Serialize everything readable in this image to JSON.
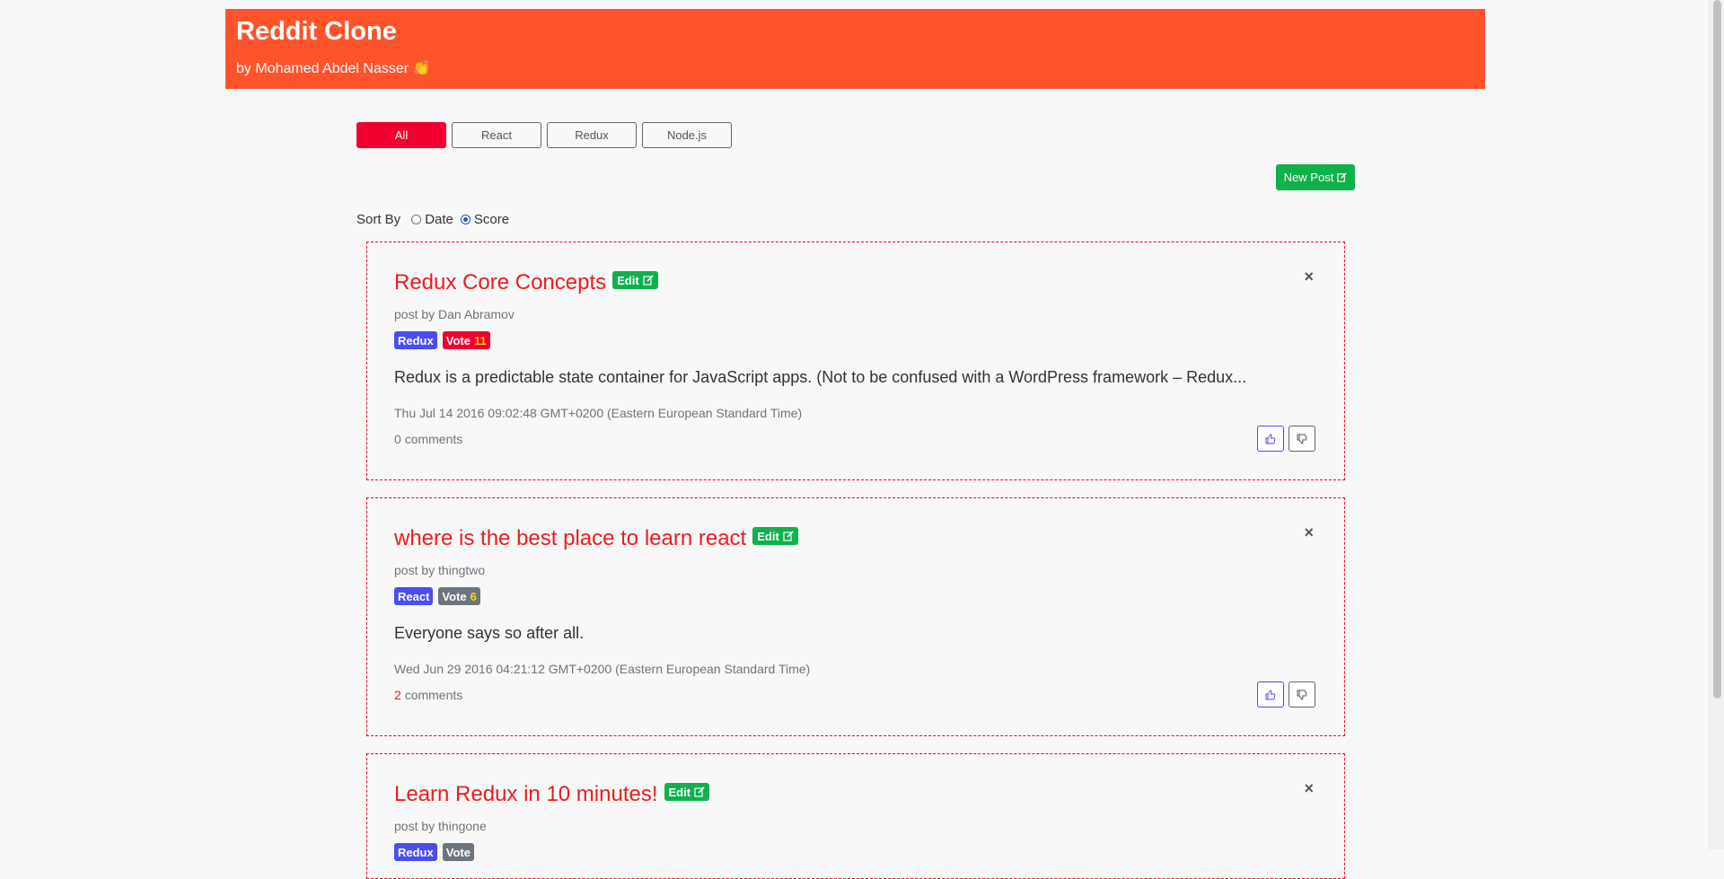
{
  "header": {
    "title": "Reddit Clone",
    "subtitle": "by Mohamed Abdel Nasser 👏",
    "bg_color": "#ff532b"
  },
  "categories": {
    "items": [
      "All",
      "React",
      "Redux",
      "Node.js"
    ],
    "active": "All",
    "active_color": "#f0002f"
  },
  "new_post": {
    "label": "New Post",
    "icon": "edit-icon",
    "color": "#0eb14a"
  },
  "sort": {
    "label": "Sort By",
    "options": [
      "Date",
      "Score"
    ],
    "selected": "Score"
  },
  "posts": [
    {
      "title": "Redux Core Concepts",
      "edit_label": "Edit",
      "author": "post by Dan Abramov",
      "category": "Redux",
      "vote_label": "Vote",
      "vote_count": "11",
      "body": "Redux is a predictable state container for JavaScript apps. (Not to be confused with a WordPress framework – Redux...",
      "timestamp": "Thu Jul 14 2016 09:02:48 GMT+0200 (Eastern European Standard Time)",
      "comment_count": "0",
      "comments_label": "comments"
    },
    {
      "title": "where is the best place to learn react",
      "edit_label": "Edit",
      "author": "post by thingtwo",
      "category": "React",
      "vote_label": "Vote",
      "vote_count": "6",
      "body": "Everyone says so after all.",
      "timestamp": "Wed Jun 29 2016 04:21:12 GMT+0200 (Eastern European Standard Time)",
      "comment_count": "2",
      "comments_label": "comments"
    },
    {
      "title": "Learn Redux in 10 minutes!",
      "edit_label": "Edit",
      "author": "post by thingone",
      "category": "Redux",
      "vote_label": "Vote"
    }
  ],
  "close_symbol": "×"
}
